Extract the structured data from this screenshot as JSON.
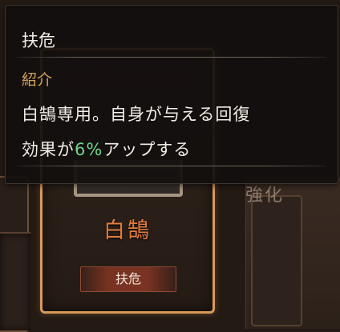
{
  "tooltip": {
    "title": "扶危",
    "section_heading": "紹介",
    "description_line1": "白鵠専用。自身が与える回復",
    "description_line2_prefix": "効果が",
    "description_line2_value": "6%",
    "description_line2_suffix": "アップする"
  },
  "card": {
    "hero_name": "白鵠",
    "skill_label": "扶危"
  },
  "background": {
    "partial_text": "強化"
  },
  "colors": {
    "tooltip_heading": "#d3a35b",
    "value_highlight": "#6ed38a",
    "hero_name": "#e27d3e",
    "card_border": "#d9995a"
  }
}
